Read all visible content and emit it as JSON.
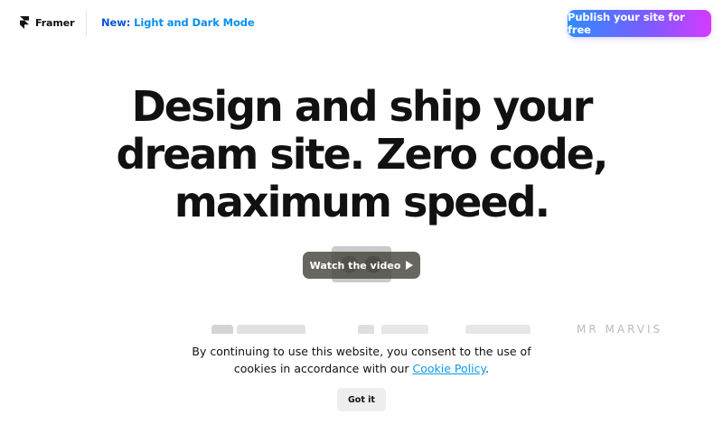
{
  "header": {
    "brand_name": "Framer",
    "brand_icon": "framer-logo-icon",
    "announcement_prefix": "New:",
    "announcement_text": "Light and Dark Mode",
    "cta_label": "Publish your site for free",
    "cta_gradient": [
      "#2f8cff",
      "#7a5cff",
      "#d43bff"
    ]
  },
  "hero": {
    "title_line_1": "Design and ship your",
    "title_line_2": "dream site. Zero code,",
    "title_line_3": "maximum speed.",
    "video_button_label": "Watch the video",
    "video_button_icon": "play-icon"
  },
  "logos": {
    "visible_text": "MR MARVIS"
  },
  "cookie_banner": {
    "text_before_link": "By continuing to use this website, you consent to the use of cookies in accordance with our ",
    "link_text": "Cookie Policy",
    "text_after_link": ".",
    "button_label": "Got it"
  }
}
